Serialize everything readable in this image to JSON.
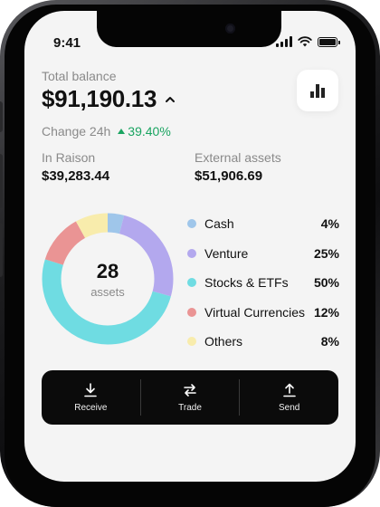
{
  "status_bar": {
    "time": "9:41"
  },
  "balance": {
    "label": "Total balance",
    "value": "$91,190.13",
    "change_label": "Change 24h",
    "change_value": "39.40%"
  },
  "stats": {
    "raison_label": "In Raison",
    "raison_value": "$39,283.44",
    "external_label": "External assets",
    "external_value": "$51,906.69"
  },
  "donut": {
    "count": "28",
    "unit": "assets"
  },
  "allocation": [
    {
      "name": "Cash",
      "pct": "4%",
      "value": 4,
      "color": "#9fc6ea"
    },
    {
      "name": "Venture",
      "pct": "25%",
      "value": 25,
      "color": "#b3a8ee"
    },
    {
      "name": "Stocks & ETFs",
      "pct": "50%",
      "value": 50,
      "color": "#6fdce2"
    },
    {
      "name": "Virtual Currencies",
      "pct": "12%",
      "value": 12,
      "color": "#ea9494"
    },
    {
      "name": "Others",
      "pct": "8%",
      "value": 8,
      "color": "#f8ecac"
    }
  ],
  "actions": {
    "receive": "Receive",
    "trade": "Trade",
    "send": "Send"
  },
  "colors": {
    "positive": "#1aa461",
    "action_bar": "#0b0b0b"
  }
}
